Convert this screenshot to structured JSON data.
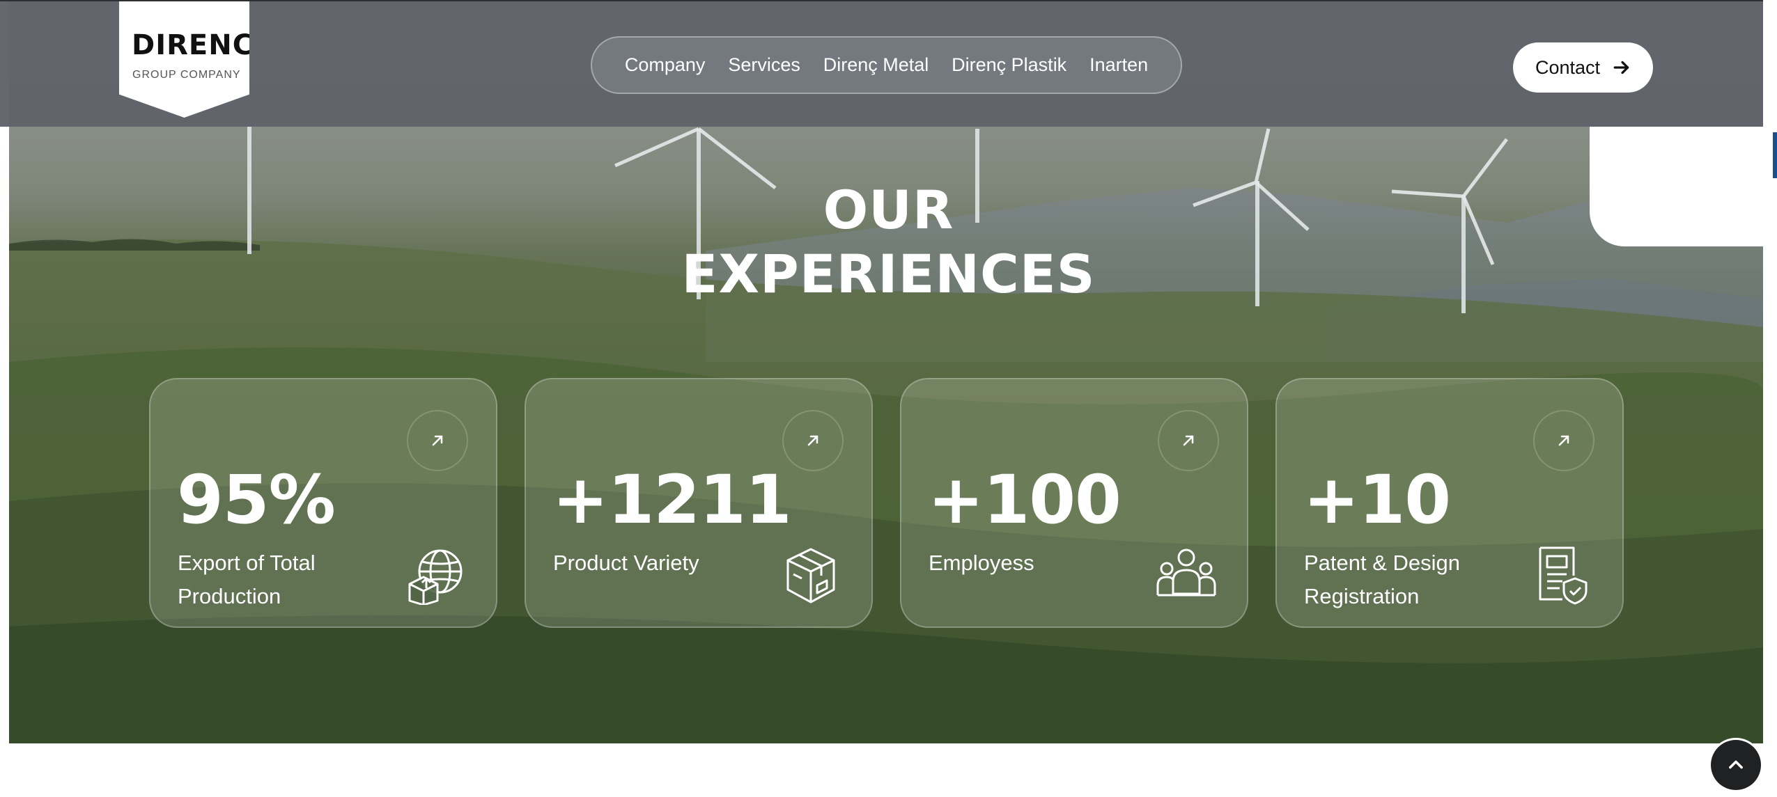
{
  "header": {
    "logo": {
      "title": "DIRENC",
      "subtitle": "GROUP COMPANY"
    },
    "nav": [
      {
        "label": "Company"
      },
      {
        "label": "Services"
      },
      {
        "label": "Direnç Metal"
      },
      {
        "label": "Direnç Plastik"
      },
      {
        "label": "Inarten"
      }
    ],
    "contact_label": "Contact"
  },
  "section": {
    "title_line1": "OUR",
    "title_line2": "EXPERIENCES"
  },
  "cards": [
    {
      "value": "95%",
      "label": "Export of Total Production",
      "icon": "globe-box-icon"
    },
    {
      "value": "+1211",
      "label": "Product Variety",
      "icon": "package-icon"
    },
    {
      "value": "+100",
      "label": "Employess",
      "icon": "people-icon"
    },
    {
      "value": "+10",
      "label": "Patent & Design Registration",
      "icon": "certificate-icon"
    }
  ],
  "colors": {
    "header_bg": "#60636a",
    "card_bg": "rgba(255,255,255,0.17)",
    "accent_blue": "#1c4e93",
    "scroll_button": "#1f2123"
  }
}
